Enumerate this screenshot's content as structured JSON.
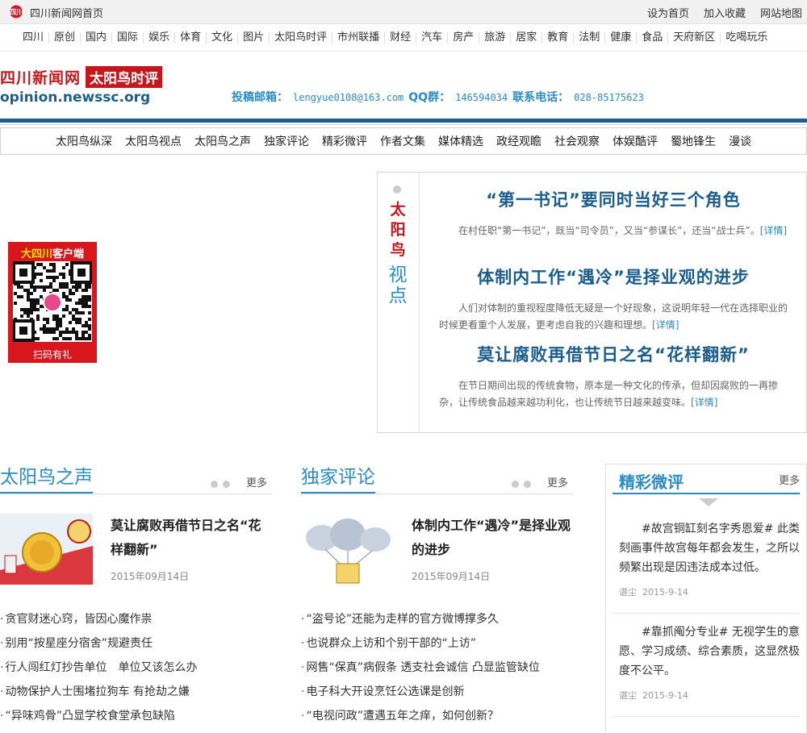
{
  "topbar": {
    "home": "四川新闻网首页",
    "links": [
      "设为首页",
      "加入收藏",
      "网站地图"
    ]
  },
  "channels": [
    "四川",
    "原创",
    "国内",
    "国际",
    "娱乐",
    "体育",
    "文化",
    "图片",
    "太阳鸟时评",
    "市州联播",
    "财经",
    "汽车",
    "房产",
    "旅游",
    "居家",
    "教育",
    "法制",
    "健康",
    "食品",
    "天府新区",
    "吃喝玩乐"
  ],
  "header": {
    "brand": "四川新闻网",
    "tag": "太阳鸟时评",
    "url": "opinion.newssc.org",
    "email_label": "投稿邮箱：",
    "email": "lengyue0108@163.com",
    "qq_label": "QQ群：",
    "qq": "146594034",
    "phone_label": "联系电话：",
    "phone": "028-85175623"
  },
  "section_nav": [
    "太阳鸟纵深",
    "太阳鸟视点",
    "太阳鸟之声",
    "独家评论",
    "精彩微评",
    "作者文集",
    "媒体精选",
    "政经观瞻",
    "社会观察",
    "体娱酷评",
    "蜀地锋生",
    "漫谈"
  ],
  "qr": {
    "title_a": "大四川",
    "title_b": "客户端",
    "caption": "扫码有礼"
  },
  "viewpoint": {
    "label_red": "太阳鸟",
    "label_blue": "视点",
    "items": [
      {
        "title": "“第一书记”要同时当好三个角色",
        "summary": "在村任职“第一书记”，既当“司令员”，又当“参谋长”，还当“战士兵”。",
        "more": "[详情]"
      },
      {
        "title": "体制内工作“遇冷”是择业观的进步",
        "summary": "人们对体制的重视程度降低无疑是一个好现象，这说明年轻一代在选择职业的时候更看重个人发展，更考虑自我的兴趣和理想。",
        "more": "[详情]"
      },
      {
        "title": "莫让腐败再借节日之名“花样翻新”",
        "summary": "在节日期间出现的传统食物，原本是一种文化的传承，但却因腐败的一再掺杂，让传统食品越来越功利化，也让传统节日越来越变味。",
        "more": "[详情]"
      }
    ]
  },
  "col1": {
    "title": "太阳鸟之声",
    "more": "更多",
    "feature_title": "莫让腐败再借节日之名“花样翻新”",
    "feature_date": "2015年09月14日",
    "list": [
      "贪官财迷心窍，皆因心魔作祟",
      "别用“按星座分宿舍”规避责任",
      "行人闯红灯抄告单位　单位又该怎么办",
      "动物保护人士围堵拉狗车 有抢劫之嫌",
      "“异味鸡骨”凸显学校食堂承包缺陷"
    ]
  },
  "col2": {
    "title": "独家评论",
    "more": "更多",
    "feature_title": "体制内工作“遇冷”是择业观的进步",
    "feature_date": "2015年09月14日",
    "list": [
      "“盗号论”还能为走样的官方微博撑多久",
      "也说群众上访和个别干部的“上访”",
      "网售“保真”病假条 透支社会诚信 凸显监管缺位",
      "电子科大开设烹饪公选课是创新",
      "“电视问政”遭遇五年之痒，如何创新？"
    ]
  },
  "weibo": {
    "title": "精彩微评",
    "more": "更多",
    "items": [
      {
        "text": "#故宫铜缸刻名字秀恩爱# 此类刻画事件故宫每年都会发生，之所以频繁出现是因违法成本过低。",
        "author": "谌尘",
        "date": "2015-9-14"
      },
      {
        "text": "#靠抓阄分专业# 无视学生的意愿、学习成绩、综合素质，这显然极度不公平。",
        "author": "谌尘",
        "date": "2015-9-14"
      }
    ]
  }
}
